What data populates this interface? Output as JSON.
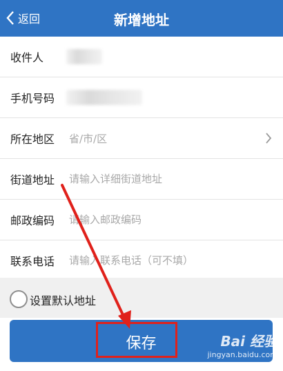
{
  "header": {
    "back_label": "返回",
    "title": "新增地址"
  },
  "form": {
    "fields": [
      {
        "label": "收件人",
        "value": "",
        "placeholder": ""
      },
      {
        "label": "手机号码",
        "value": "",
        "placeholder": ""
      },
      {
        "label": "所在地区",
        "value": "",
        "placeholder": "省/市/区"
      },
      {
        "label": "街道地址",
        "value": "",
        "placeholder": "请输入详细街道地址"
      },
      {
        "label": "邮政编码",
        "value": "",
        "placeholder": "请输入邮政编码"
      },
      {
        "label": "联系电话",
        "value": "",
        "placeholder": "请输入联系电话（可不填）"
      }
    ]
  },
  "default_option": {
    "label": "设置默认地址",
    "checked": false
  },
  "save_button": {
    "label": "保存"
  },
  "watermark": {
    "logo": "Bai 经验",
    "url": "jingyan.baidu.com"
  },
  "colors": {
    "header": "#2f74c4",
    "button": "#2f74c4",
    "annotation": "#e0211b"
  }
}
